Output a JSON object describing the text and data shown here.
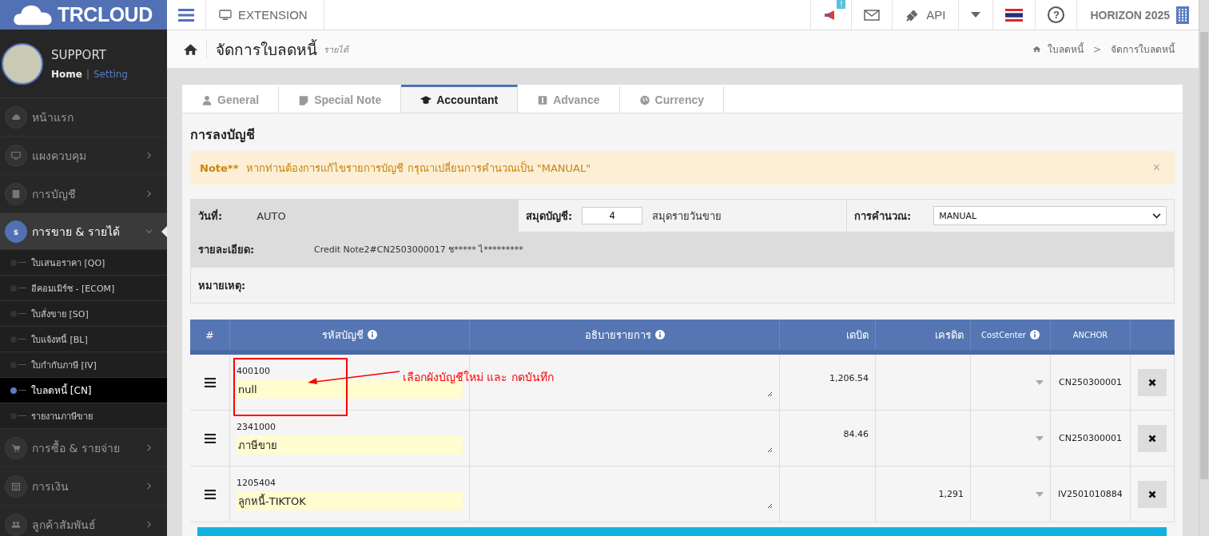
{
  "brand": "TRCLOUD",
  "topbar": {
    "extension": "EXTENSION",
    "notification_badge": "!",
    "api": "API",
    "help": "?",
    "company": "HORIZON 2025"
  },
  "user": {
    "name": "SUPPORT",
    "link_separator": "|",
    "links": [
      {
        "label": "Home",
        "selected": true
      },
      {
        "label": "Setting",
        "selected": false
      }
    ]
  },
  "sidebar": {
    "items": [
      {
        "label": "หน้าแรก",
        "kind": "link",
        "expanded": false
      },
      {
        "label": "แผงควบคุม",
        "kind": "group",
        "expanded": false
      },
      {
        "label": "การบัญชี",
        "kind": "group",
        "expanded": false
      },
      {
        "label": "การขาย & รายได้",
        "kind": "group",
        "expanded": true,
        "icon_glyph": "$",
        "children": [
          {
            "label": "ใบเสนอราคา [QO]",
            "selected": false
          },
          {
            "label": "อีคอมเมิร์ซ - [ECOM]",
            "selected": false
          },
          {
            "label": "ใบสั่งขาย [SO]",
            "selected": false
          },
          {
            "label": "ใบแจ้งหนี้ [BL]",
            "selected": false
          },
          {
            "label": "ใบกำกับภาษี [IV]",
            "selected": false
          },
          {
            "label": "ใบลดหนี้ [CN]",
            "selected": true
          },
          {
            "label": "รายงานภาษีขาย",
            "selected": false
          }
        ]
      },
      {
        "label": "การซื้อ & รายจ่าย",
        "kind": "group",
        "expanded": false
      },
      {
        "label": "การเงิน",
        "kind": "group",
        "expanded": false
      },
      {
        "label": "ลูกค้าสัมพันธ์",
        "kind": "group",
        "expanded": false
      }
    ]
  },
  "page": {
    "title": "จัดการใบลดหนี้",
    "subtitle": "รายได้",
    "breadcrumb": [
      "ใบลดหนี้",
      "จัดการใบลดหนี้"
    ],
    "breadcrumb_separator": ">"
  },
  "tabs": [
    {
      "label": "General",
      "selected": false
    },
    {
      "label": "Special Note",
      "selected": false
    },
    {
      "label": "Accountant",
      "selected": true
    },
    {
      "label": "Advance",
      "selected": false
    },
    {
      "label": "Currency",
      "selected": false
    }
  ],
  "section_title": "การลงบัญชี",
  "alert": {
    "label": "Note**",
    "text": "หากท่านต้องการแก้ไขรายการบัญชี กรุณาเปลี่ยนการคำนวณเป็น \"MANUAL\"",
    "close": "×"
  },
  "form": {
    "date_label": "วันที่:",
    "date_value": "AUTO",
    "book_label": "สมุดบัญชี:",
    "book_value": "4",
    "book_name": "สมุดรายวันขาย",
    "calc_label": "การคำนวณ:",
    "calc_value": "MANUAL",
    "detail_label": "รายละเอียด:",
    "detail_value": "Credit Note2#CN2503000017 ช***** ไ*********",
    "remark_label": "หมายเหตุ:"
  },
  "table": {
    "columns": [
      {
        "label": "#",
        "info_icon": false
      },
      {
        "label": "รหัสบัญชี",
        "info_icon": true
      },
      {
        "label": "อธิบายรายการ",
        "info_icon": true
      },
      {
        "label": "เดบิต",
        "info_icon": false
      },
      {
        "label": "เครดิต",
        "info_icon": false
      },
      {
        "label": "CostCenter",
        "info_icon": true
      },
      {
        "label": "ANCHOR",
        "info_icon": false
      }
    ],
    "rows": [
      {
        "code": "400100",
        "name": "null",
        "debit": "1,206.54",
        "anchor": "CN250300001"
      },
      {
        "code": "2341000",
        "name": "ภาษีขาย",
        "debit": "84.46",
        "anchor": "CN250300001"
      },
      {
        "code": "1205404",
        "name": "ลูกหนี้-TIKTOK",
        "credit": "1,291",
        "anchor": "IV2501010884"
      }
    ]
  },
  "annotation": {
    "text": "เลือกผังบัญชีใหม่ และ กดบันทึก",
    "color": "#ff0000"
  }
}
